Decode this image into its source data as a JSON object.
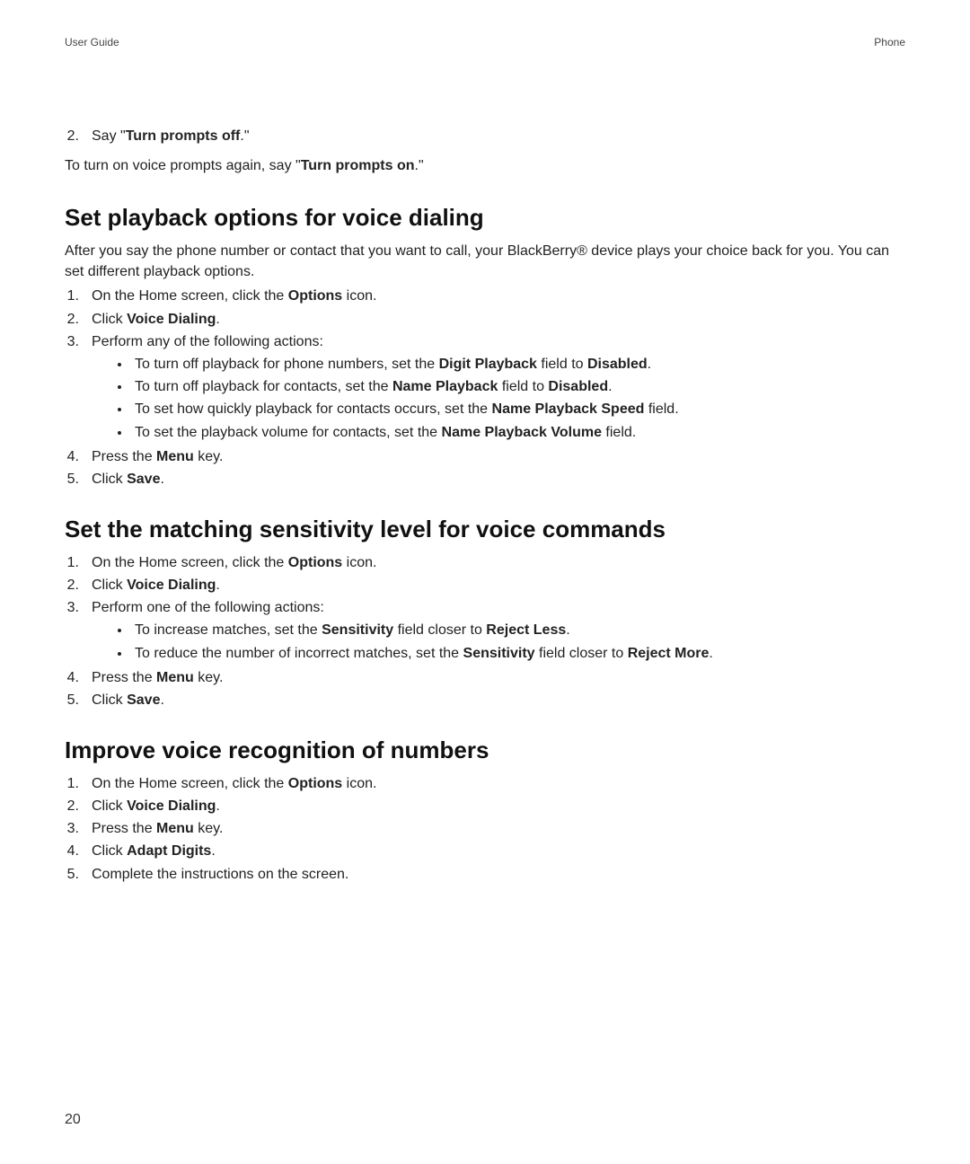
{
  "header": {
    "left": "User Guide",
    "right": "Phone"
  },
  "page_number": "20",
  "top_continuation": {
    "step2_marker": "2.",
    "step2_pre": "Say \"",
    "step2_bold": "Turn prompts off",
    "step2_post": ".\"",
    "para_pre": "To turn on voice prompts again, say \"",
    "para_bold": "Turn prompts on",
    "para_post": ".\""
  },
  "section1": {
    "title": "Set playback options for voice dialing",
    "intro": "After you say the phone number or contact that you want to call, your BlackBerry® device plays your choice back for you. You can set different playback options.",
    "s1_pre": "On the Home screen, click the ",
    "s1_bold": "Options",
    "s1_post": " icon.",
    "s2_pre": "Click ",
    "s2_bold": "Voice Dialing",
    "s2_post": ".",
    "s3": "Perform any of the following actions:",
    "b1_pre": "To turn off playback for phone numbers, set the ",
    "b1_bold1": "Digit Playback",
    "b1_mid": " field to ",
    "b1_bold2": "Disabled",
    "b1_post": ".",
    "b2_pre": "To turn off playback for contacts, set the ",
    "b2_bold1": "Name Playback",
    "b2_mid": " field to ",
    "b2_bold2": "Disabled",
    "b2_post": ".",
    "b3_pre": "To set how quickly playback for contacts occurs, set the ",
    "b3_bold": "Name Playback Speed",
    "b3_post": " field.",
    "b4_pre": "To set the playback volume for contacts, set the ",
    "b4_bold": "Name Playback Volume",
    "b4_post": " field.",
    "s4_pre": "Press the ",
    "s4_bold": "Menu",
    "s4_post": " key.",
    "s5_pre": "Click ",
    "s5_bold": "Save",
    "s5_post": "."
  },
  "section2": {
    "title": "Set the matching sensitivity level for voice commands",
    "s1_pre": "On the Home screen, click the ",
    "s1_bold": "Options",
    "s1_post": " icon.",
    "s2_pre": "Click ",
    "s2_bold": "Voice Dialing",
    "s2_post": ".",
    "s3": "Perform one of the following actions:",
    "b1_pre": "To increase matches, set the ",
    "b1_bold1": "Sensitivity",
    "b1_mid": " field closer to ",
    "b1_bold2": "Reject Less",
    "b1_post": ".",
    "b2_pre": "To reduce the number of incorrect matches, set the ",
    "b2_bold1": "Sensitivity",
    "b2_mid": " field closer to ",
    "b2_bold2": "Reject More",
    "b2_post": ".",
    "s4_pre": "Press the ",
    "s4_bold": "Menu",
    "s4_post": " key.",
    "s5_pre": "Click ",
    "s5_bold": "Save",
    "s5_post": "."
  },
  "section3": {
    "title": "Improve voice recognition of numbers",
    "s1_pre": "On the Home screen, click the ",
    "s1_bold": "Options",
    "s1_post": " icon.",
    "s2_pre": "Click ",
    "s2_bold": "Voice Dialing",
    "s2_post": ".",
    "s3_pre": "Press the ",
    "s3_bold": "Menu",
    "s3_post": " key.",
    "s4_pre": "Click ",
    "s4_bold": "Adapt Digits",
    "s4_post": ".",
    "s5": "Complete the instructions on the screen."
  },
  "markers": {
    "n1": "1.",
    "n2": "2.",
    "n3": "3.",
    "n4": "4.",
    "n5": "5."
  }
}
